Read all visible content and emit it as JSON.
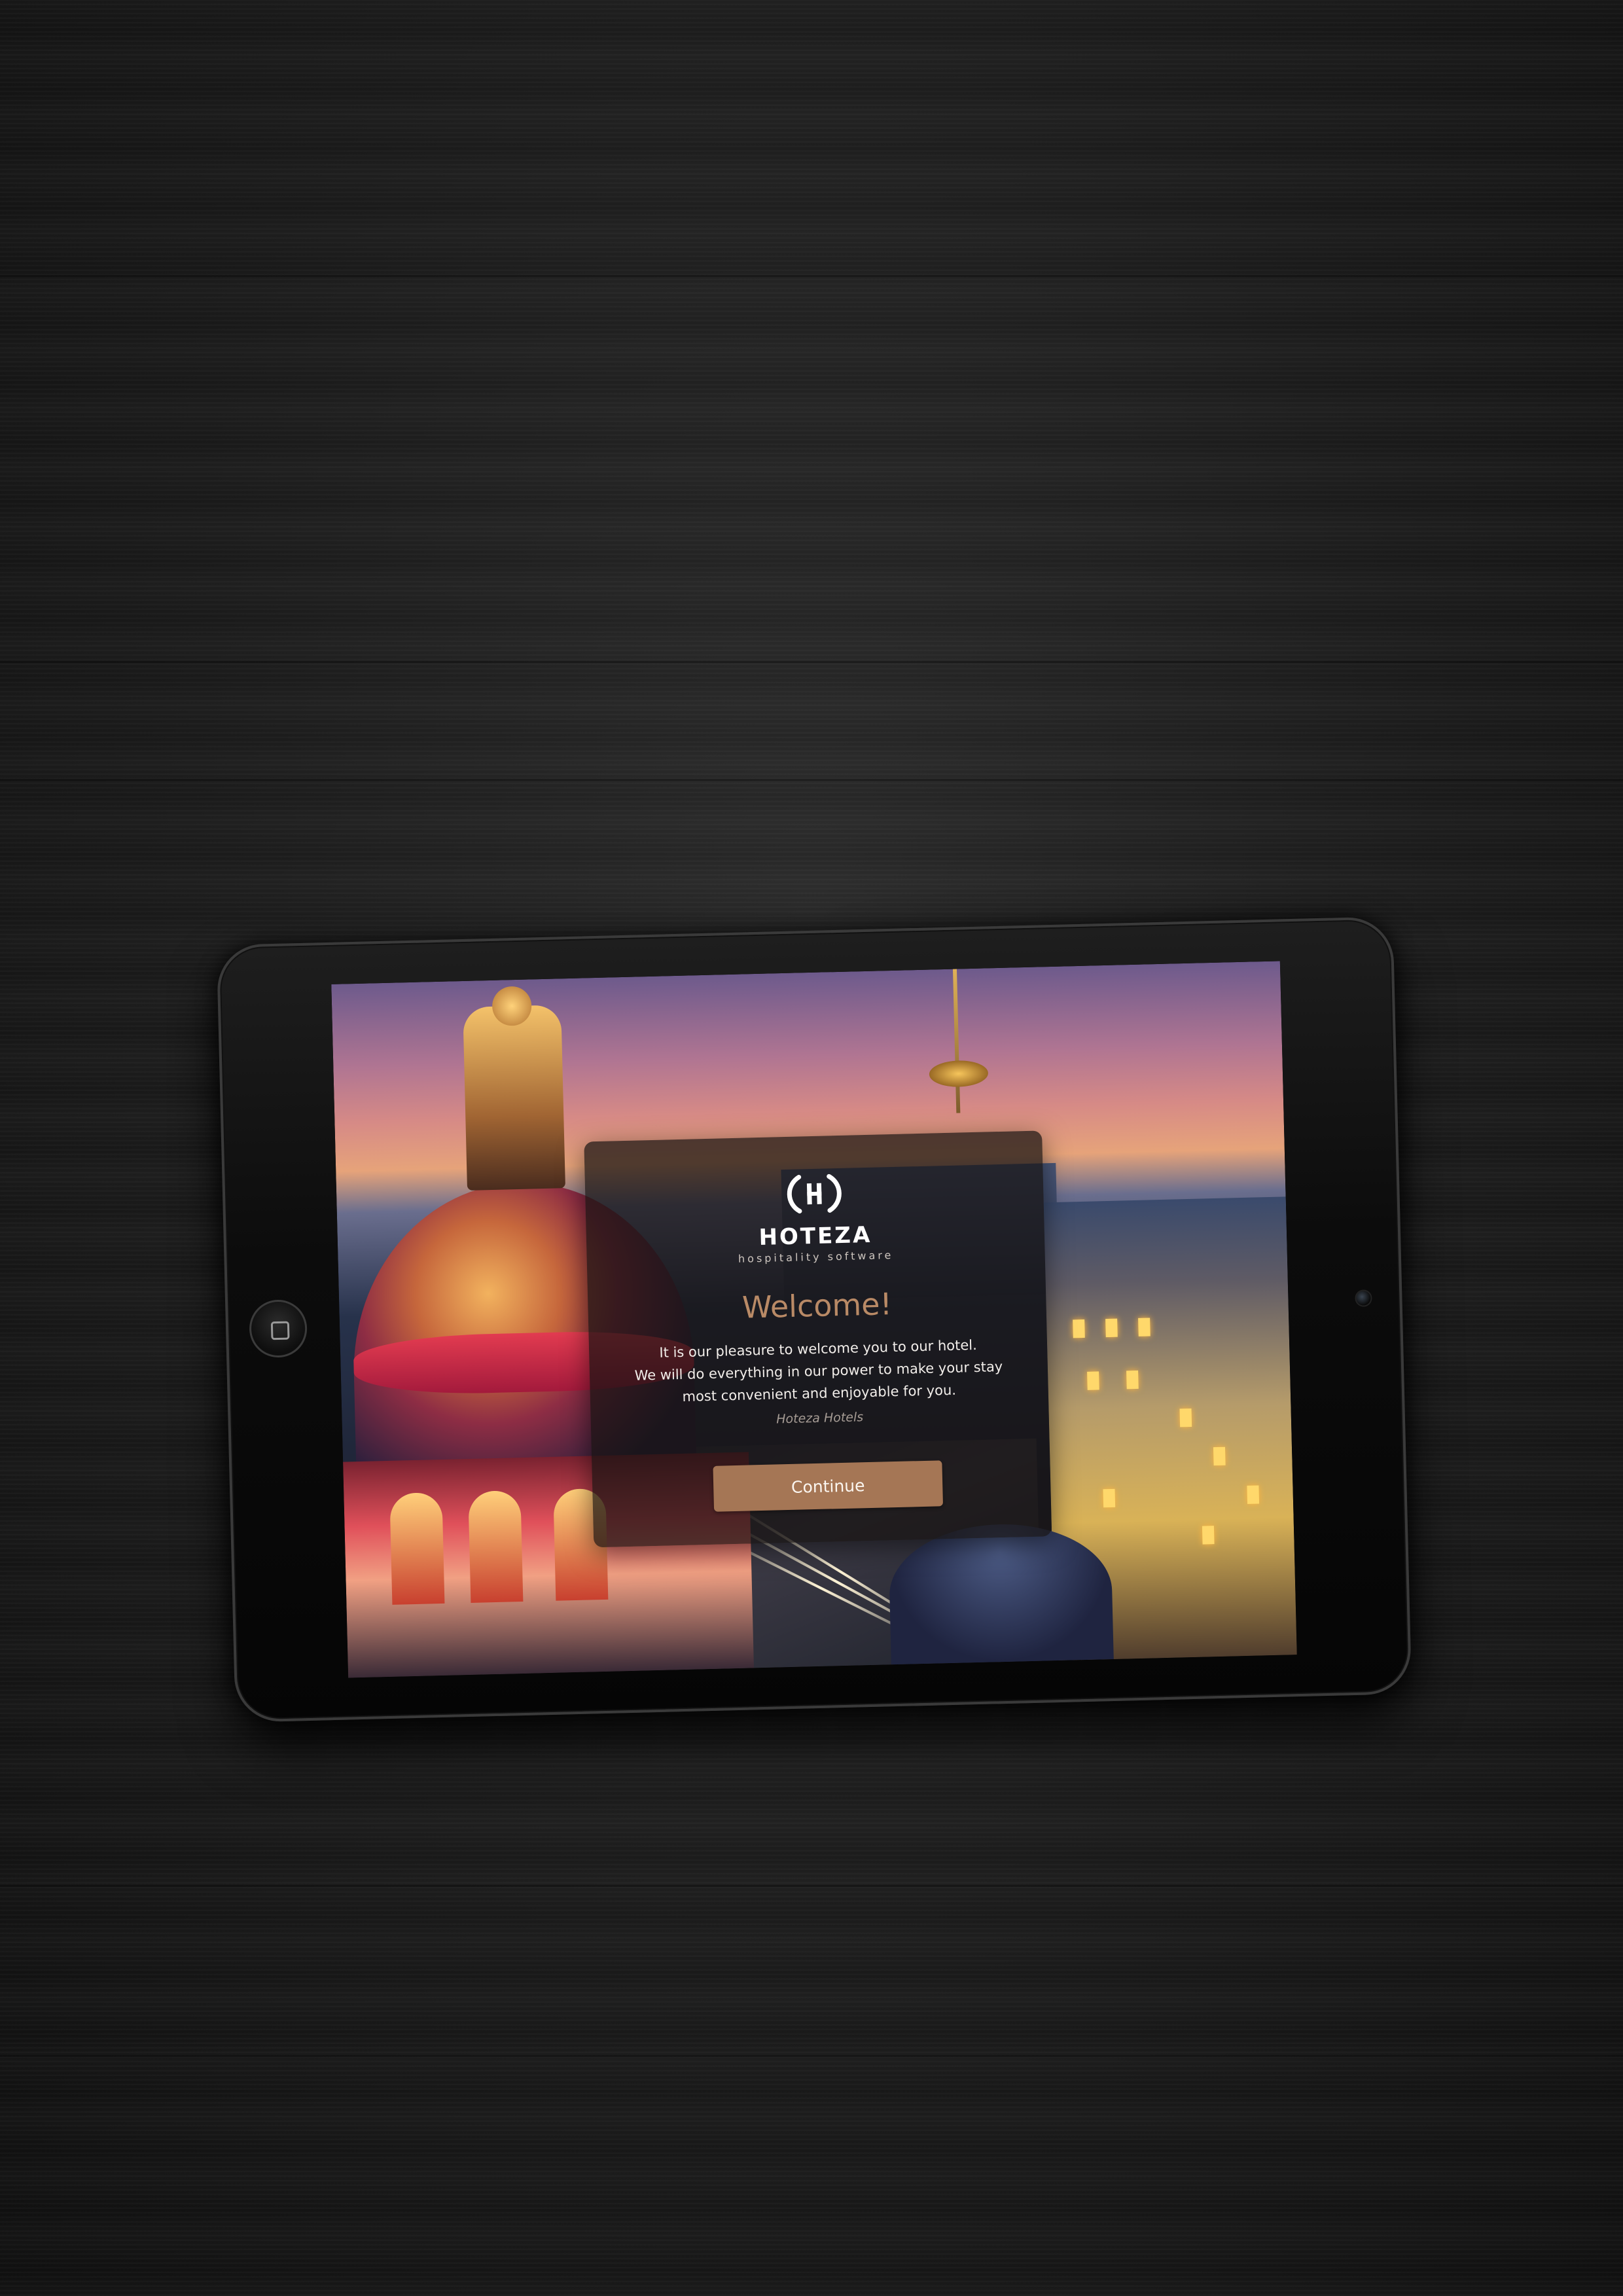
{
  "brand": {
    "name": "HOTEZA",
    "tagline": "hospitality software",
    "logo_icon": "hoteza-h-logo-icon"
  },
  "welcome": {
    "title": "Welcome!",
    "lines": [
      "It is our pleasure to welcome you to our hotel.",
      "We will do everything in our power to make your stay",
      "most convenient and enjoyable for you."
    ],
    "signature": "Hoteza Hotels",
    "continue_label": "Continue"
  },
  "colors": {
    "accent": "#b98a66",
    "button": "#a57655",
    "card_bg": "rgba(22,18,16,0.72)",
    "background": "#1b1b1b"
  },
  "device": {
    "home_button_icon": "home-button-icon",
    "camera_icon": "front-camera-icon"
  }
}
